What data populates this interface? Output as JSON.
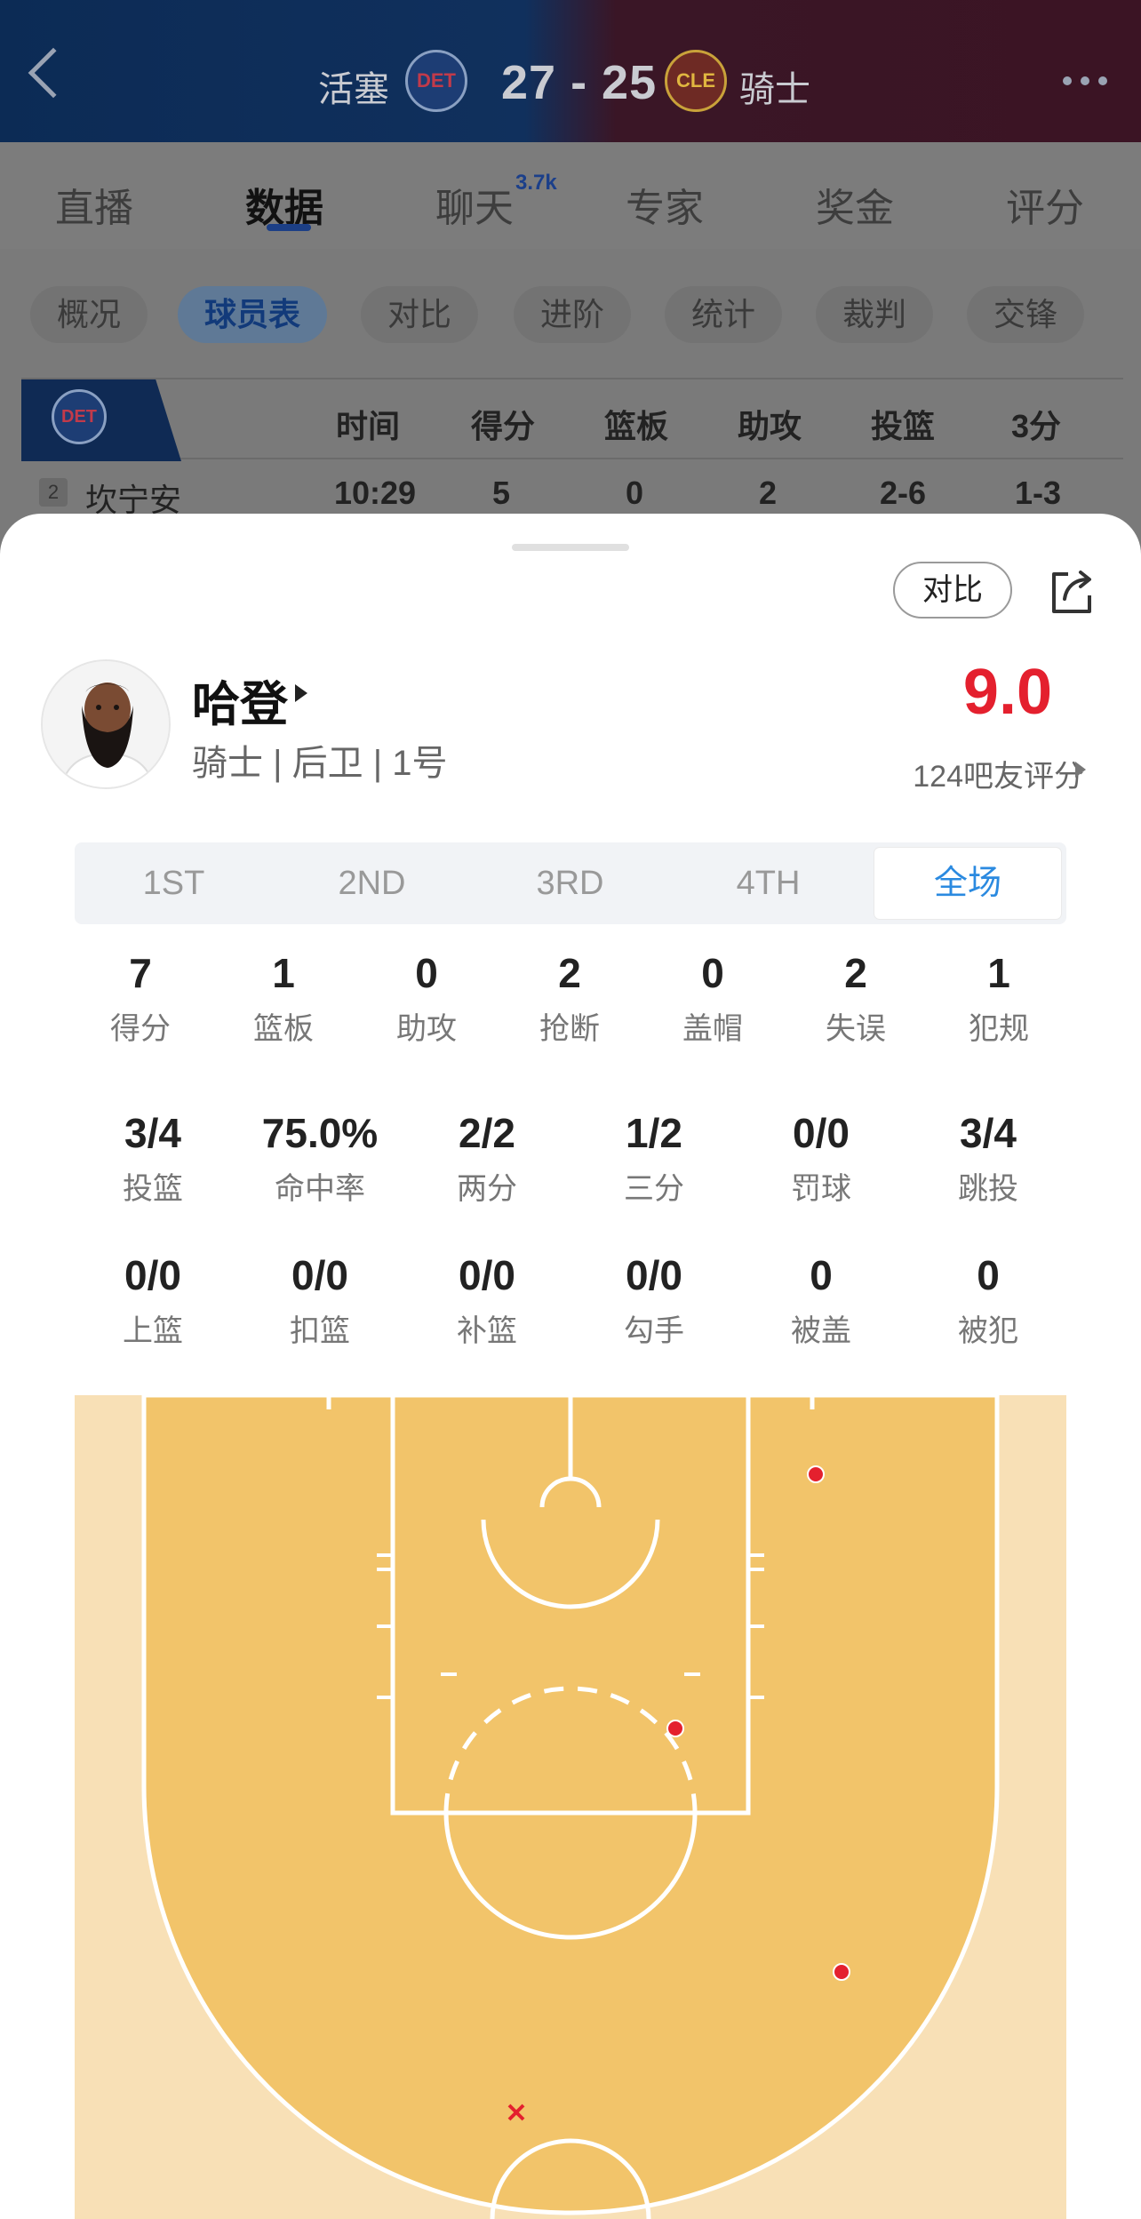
{
  "header": {
    "home_team": "活塞",
    "home_logo": "DET",
    "away_team": "骑士",
    "away_logo": "CLE",
    "score": "27 - 25"
  },
  "tabs": [
    {
      "label": "直播"
    },
    {
      "label": "数据"
    },
    {
      "label": "聊天"
    },
    {
      "label": "专家"
    },
    {
      "label": "奖金"
    },
    {
      "label": "评分"
    }
  ],
  "chat_badge": "3.7k",
  "chips": [
    {
      "label": "概况"
    },
    {
      "label": "球员表"
    },
    {
      "label": "对比"
    },
    {
      "label": "进阶"
    },
    {
      "label": "统计"
    },
    {
      "label": "裁判"
    },
    {
      "label": "交锋"
    }
  ],
  "table": {
    "team_logo": "DET",
    "columns": [
      "时间",
      "得分",
      "篮板",
      "助攻",
      "投篮",
      "3分"
    ],
    "row": {
      "number": "2",
      "name": "坎宁安",
      "cells": [
        "10:29",
        "5",
        "0",
        "2",
        "2-6",
        "1-3"
      ]
    }
  },
  "sheet": {
    "compare_label": "对比",
    "player_name": "哈登",
    "player_info": "骑士 | 后卫 | 1号",
    "rating": "9.0",
    "raters": "124吧友评分",
    "periods": [
      "1ST",
      "2ND",
      "3RD",
      "4TH",
      "全场"
    ],
    "active_period": "全场",
    "stats_row1": [
      {
        "v": "7",
        "l": "得分"
      },
      {
        "v": "1",
        "l": "篮板"
      },
      {
        "v": "0",
        "l": "助攻"
      },
      {
        "v": "2",
        "l": "抢断"
      },
      {
        "v": "0",
        "l": "盖帽"
      },
      {
        "v": "2",
        "l": "失误"
      },
      {
        "v": "1",
        "l": "犯规"
      }
    ],
    "stats_row2": [
      {
        "v": "3/4",
        "l": "投篮"
      },
      {
        "v": "75.0%",
        "l": "命中率"
      },
      {
        "v": "2/2",
        "l": "两分"
      },
      {
        "v": "1/2",
        "l": "三分"
      },
      {
        "v": "0/0",
        "l": "罚球"
      },
      {
        "v": "3/4",
        "l": "跳投"
      }
    ],
    "stats_row3": [
      {
        "v": "0/0",
        "l": "上篮"
      },
      {
        "v": "0/0",
        "l": "扣篮"
      },
      {
        "v": "0/0",
        "l": "补篮"
      },
      {
        "v": "0/0",
        "l": "勾手"
      },
      {
        "v": "0",
        "l": "被盖"
      },
      {
        "v": "0",
        "l": "被犯"
      }
    ]
  },
  "colors": {
    "accent_blue": "#2b8ae0",
    "rating_red": "#e4202e",
    "court_inner": "#f2c46a",
    "court_outer": "#f8e0b6"
  }
}
